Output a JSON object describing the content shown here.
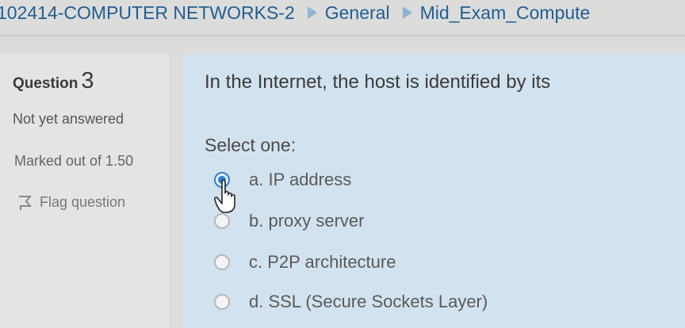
{
  "breadcrumb": {
    "course": "102414-COMPUTER NETWORKS-2",
    "section": "General",
    "quiz": "Mid_Exam_Compute"
  },
  "question_info": {
    "label": "Question",
    "number": "3",
    "status": "Not yet answered",
    "marks": "Marked out of 1.50",
    "flag_label": "Flag question"
  },
  "question": {
    "text": "In the Internet, the host is identified by its",
    "prompt": "Select one:",
    "options": [
      {
        "label": "a. IP address",
        "selected": true
      },
      {
        "label": "b. proxy server",
        "selected": false
      },
      {
        "label": "c. P2P architecture",
        "selected": false
      },
      {
        "label": "d. SSL (Secure Sockets Layer)",
        "selected": false
      }
    ]
  },
  "colors": {
    "link": "#1f5e96",
    "content_bg": "#d2e2ee",
    "info_bg": "#e4e4e2",
    "radio_selected": "#2a7fd8"
  }
}
